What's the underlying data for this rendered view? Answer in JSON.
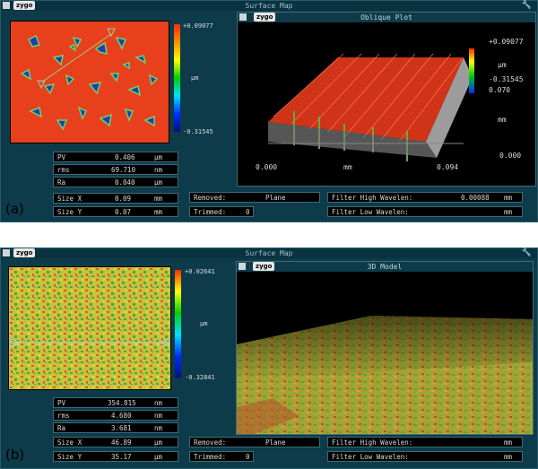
{
  "panel_a": {
    "label": "(a)",
    "window_title": "Surface Map",
    "logo": "zygo",
    "scale_max": "+0.09077",
    "scale_unit": "µm",
    "scale_min": "-0.31545",
    "plot_title": "Oblique Plot",
    "plot_logo": "zygo",
    "plot_scale_max": "+0.09077",
    "plot_scale_unit": "µm",
    "plot_scale_min": "-0.31545",
    "axis_x_start": "0.000",
    "axis_x_unit": "mm",
    "axis_x_end": "0.094",
    "axis_y_top": "0.070",
    "axis_y_unit": "mm",
    "axis_y_zero": "0.000",
    "stats": [
      {
        "name": "PV",
        "value": "0.406",
        "unit": "µm"
      },
      {
        "name": "rms",
        "value": "69.710",
        "unit": "nm"
      },
      {
        "name": "Ra",
        "value": "0.040",
        "unit": "µm"
      },
      {
        "name": "Size X",
        "value": "0.09",
        "unit": "mm"
      },
      {
        "name": "Size Y",
        "value": "0.07",
        "unit": "mm"
      }
    ],
    "removed_label": "Removed:",
    "removed_value": "Plane",
    "trimmed_label": "Trimmed:",
    "trimmed_value": "0",
    "filter_high_label": "Filter High Wavelen:",
    "filter_high_value": "0.00088",
    "filter_high_unit": "mm",
    "filter_low_label": "Filter Low  Wavelen:",
    "filter_low_unit": "mm"
  },
  "panel_b": {
    "label": "(b)",
    "window_title": "Surface Map",
    "logo": "zygo",
    "scale_max": "+0.02641",
    "scale_unit": "µm",
    "scale_min": "-0.32841",
    "plot_title": "3D Model",
    "plot_logo": "zygo",
    "stats": [
      {
        "name": "PV",
        "value": "354.815",
        "unit": "nm"
      },
      {
        "name": "rms",
        "value": "4.680",
        "unit": "nm"
      },
      {
        "name": "Ra",
        "value": "3.681",
        "unit": "nm"
      },
      {
        "name": "Size X",
        "value": "46.89",
        "unit": "µm"
      },
      {
        "name": "Size Y",
        "value": "35.17",
        "unit": "µm"
      }
    ],
    "removed_label": "Removed:",
    "removed_value": "Plane",
    "trimmed_label": "Trimmed:",
    "trimmed_value": "0",
    "filter_high_label": "Filter High Wavelen:",
    "filter_high_unit": "mm",
    "filter_low_label": "Filter Low  Wavelen:",
    "filter_low_unit": "mm"
  },
  "colors": {
    "panel_bg": "#0d3b4a",
    "map_a": "#e8401c",
    "map_b": "#c9c23a"
  }
}
